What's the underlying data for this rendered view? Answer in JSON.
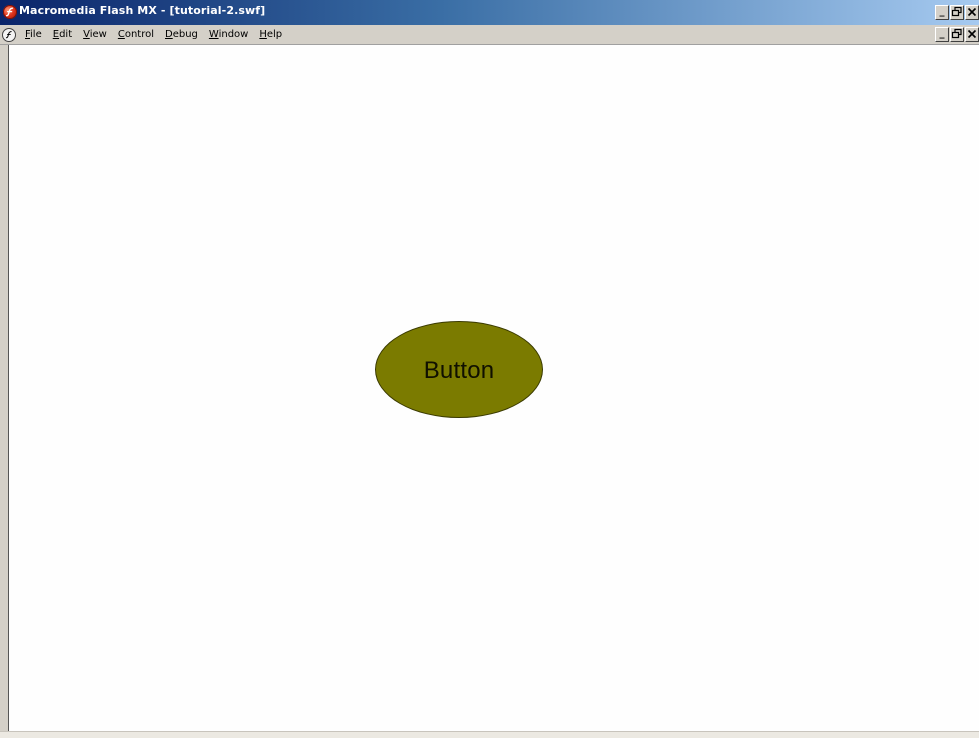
{
  "window": {
    "title": "Macromedia Flash MX - [tutorial-2.swf]",
    "app_icon": "flash-player-icon",
    "title_controls": {
      "minimize": "_",
      "restore": "🗗",
      "close": "✕"
    }
  },
  "menubar": {
    "doc_icon": "flash-document-icon",
    "items": [
      {
        "id": "file",
        "label": "File",
        "accelerator": "F"
      },
      {
        "id": "edit",
        "label": "Edit",
        "accelerator": "E"
      },
      {
        "id": "view",
        "label": "View",
        "accelerator": "V"
      },
      {
        "id": "control",
        "label": "Control",
        "accelerator": "C"
      },
      {
        "id": "debug",
        "label": "Debug",
        "accelerator": "D"
      },
      {
        "id": "window",
        "label": "Window",
        "accelerator": "W"
      },
      {
        "id": "help",
        "label": "Help",
        "accelerator": "H"
      }
    ],
    "doc_controls": {
      "minimize": "_",
      "restore": "🗗",
      "close": "✕"
    }
  },
  "stage": {
    "button_label": "Button",
    "button_color": "#7b7b00",
    "background_color": "#fefefe"
  },
  "colors": {
    "titlebar_start": "#0a246a",
    "titlebar_end": "#a6caf0",
    "chrome": "#d4d0c8"
  }
}
